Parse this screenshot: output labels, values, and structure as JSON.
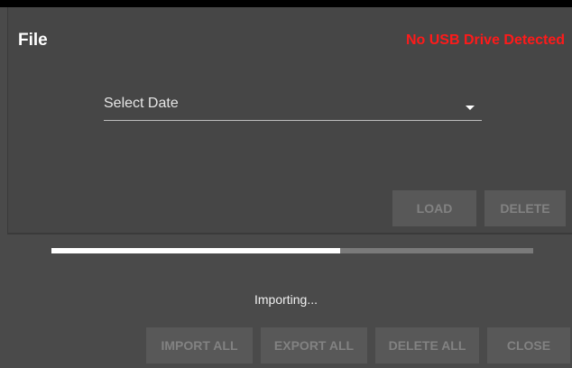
{
  "dialog": {
    "title": "File",
    "usb_status": "No USB Drive Detected",
    "usb_status_color": "#ff1a1a"
  },
  "date_select": {
    "label": "Select Date",
    "icon": "chevron-down-icon"
  },
  "actions": {
    "load_label": "LOAD",
    "delete_label": "DELETE"
  },
  "progress": {
    "fraction": 0.6,
    "status_text": "Importing..."
  },
  "footer": {
    "import_all_label": "IMPORT ALL",
    "export_all_label": "EXPORT ALL",
    "delete_all_label": "DELETE ALL",
    "close_label": "CLOSE"
  }
}
